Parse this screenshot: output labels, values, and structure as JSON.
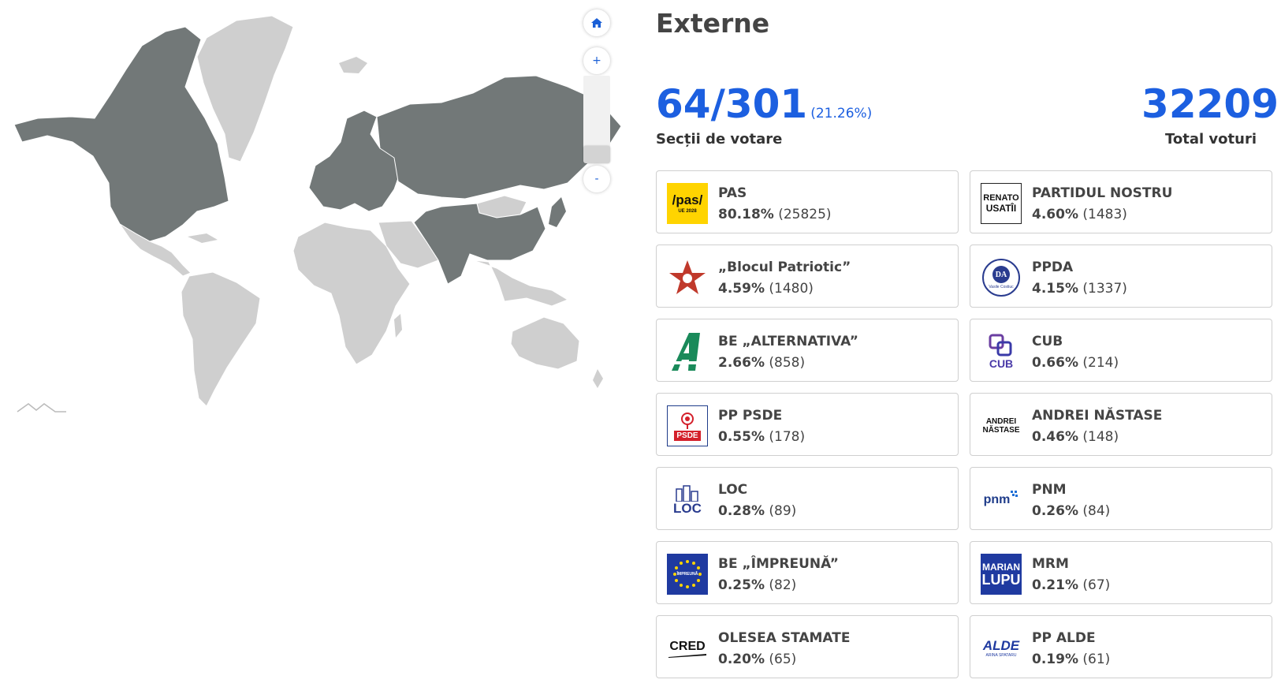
{
  "map": {
    "home_icon": "home-icon",
    "zoom_in_label": "+",
    "zoom_out_label": "-",
    "active_color": "#727878",
    "inactive_color": "#cfcfcf"
  },
  "header": {
    "title": "Externe"
  },
  "stats": {
    "sections_counted": "64/301",
    "sections_percent": "(21.26%)",
    "sections_label": "Secții de votare",
    "total_votes": "32209",
    "total_votes_label": "Total voturi",
    "accent_color": "#1c5fe0"
  },
  "parties": [
    {
      "name": "PAS",
      "pct": "80.18%",
      "votes": "(25825)",
      "logo": "pas-logo",
      "logo_text": "/pas/",
      "logo_sub": "UE 2028"
    },
    {
      "name": "PARTIDUL NOSTRU",
      "pct": "4.60%",
      "votes": "(1483)",
      "logo": "renato-usatii-logo",
      "logo_text": "RENATO",
      "logo_sub": "USATÎI"
    },
    {
      "name": "„Blocul Patriotic”",
      "pct": "4.59%",
      "votes": "(1480)",
      "logo": "red-star-logo"
    },
    {
      "name": "PPDA",
      "pct": "4.15%",
      "votes": "(1337)",
      "logo": "ppda-logo",
      "logo_text": "DA",
      "logo_sub": "Vasile Costiuc"
    },
    {
      "name": "BE „ALTERNATIVA”",
      "pct": "2.66%",
      "votes": "(858)",
      "logo": "alternativa-logo"
    },
    {
      "name": "CUB",
      "pct": "0.66%",
      "votes": "(214)",
      "logo": "cub-logo",
      "logo_text": "CUB"
    },
    {
      "name": "PP PSDE",
      "pct": "0.55%",
      "votes": "(178)",
      "logo": "psde-logo",
      "logo_text": "PSDE"
    },
    {
      "name": "ANDREI NĂSTASE",
      "pct": "0.46%",
      "votes": "(148)",
      "logo": "andrei-nastase-logo",
      "logo_text": "ANDREI",
      "logo_sub": "NĂSTASE"
    },
    {
      "name": "LOC",
      "pct": "0.28%",
      "votes": "(89)",
      "logo": "loc-logo",
      "logo_text": "LOC"
    },
    {
      "name": "PNM",
      "pct": "0.26%",
      "votes": "(84)",
      "logo": "pnm-logo",
      "logo_text": "pnm"
    },
    {
      "name": "BE „ÎMPREUNĂ”",
      "pct": "0.25%",
      "votes": "(82)",
      "logo": "impreuna-logo",
      "logo_text": "ÎMPREUNĂ"
    },
    {
      "name": "MRM",
      "pct": "0.21%",
      "votes": "(67)",
      "logo": "marian-lupu-logo",
      "logo_text": "MARIAN",
      "logo_sub": "LUPU"
    },
    {
      "name": "OLESEA STAMATE",
      "pct": "0.20%",
      "votes": "(65)",
      "logo": "cred-logo",
      "logo_text": "CRED"
    },
    {
      "name": "PP ALDE",
      "pct": "0.19%",
      "votes": "(61)",
      "logo": "alde-logo",
      "logo_text": "ALDE",
      "logo_sub": "ARINA SPATARU"
    }
  ]
}
